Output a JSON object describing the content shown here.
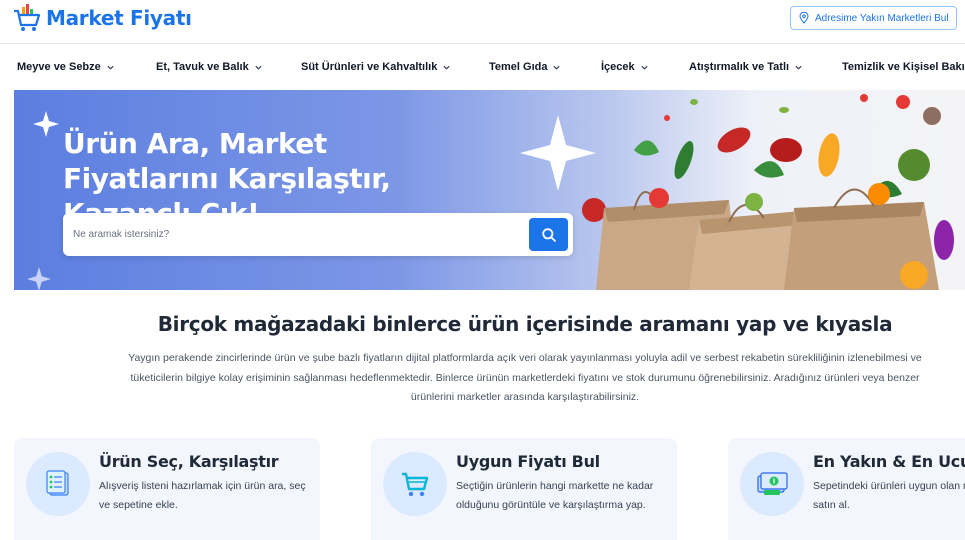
{
  "header": {
    "logo_text": "Market Fiyatı",
    "address_button": "Adresime Yakın Marketleri Bul"
  },
  "nav": {
    "items": [
      {
        "label": "Meyve ve Sebze"
      },
      {
        "label": "Et, Tavuk ve Balık"
      },
      {
        "label": "Süt Ürünleri ve Kahvaltılık"
      },
      {
        "label": "Temel Gıda"
      },
      {
        "label": "İçecek"
      },
      {
        "label": "Atıştırmalık ve Tatlı"
      },
      {
        "label": "Temizlik ve Kişisel Bakım"
      }
    ]
  },
  "hero": {
    "title": "Ürün Ara, Market Fiyatlarını Karşılaştır, Kazançlı Çık!",
    "search_placeholder": "Ne aramak istersiniz?",
    "search_value": ""
  },
  "intro": {
    "title": "Birçok mağazadaki binlerce ürün içerisinde aramanı yap ve kıyasla",
    "description": "Yaygın perakende zincirlerinde ürün ve şube bazlı fiyatların dijital platformlarda açık veri olarak yayınlanması yoluyla adil ve serbest rekabetin sürekliliğinin izlenebilmesi ve tüketicilerin bilgiye kolay erişiminin sağlanması hedeflenmektedir. Binlerce ürünün marketlerdeki fiyatını ve stok durumunu öğrenebilirsiniz. Aradığınız ürünleri veya benzer ürünlerini marketler arasında karşılaştırabilirsiniz."
  },
  "cards": [
    {
      "title": "Ürün Seç, Karşılaştır",
      "text": "Alışveriş listeni hazırlamak için ürün ara, seç ve sepetine ekle.",
      "icon": "checklist-icon"
    },
    {
      "title": "Uygun Fiyatı Bul",
      "text": "Seçtiğin ürünlerin hangi markette ne kadar olduğunu görüntüle ve karşılaştırma yap.",
      "icon": "cart-icon"
    },
    {
      "title": "En Yakın & En Ucuz",
      "text": "Sepetindeki ürünleri uygun olan marketten satın al.",
      "icon": "money-icon"
    }
  ],
  "colors": {
    "brand": "#1c74e9",
    "hero_gradient_start": "#5b7ee0",
    "card_bg": "#f3f7fd"
  }
}
